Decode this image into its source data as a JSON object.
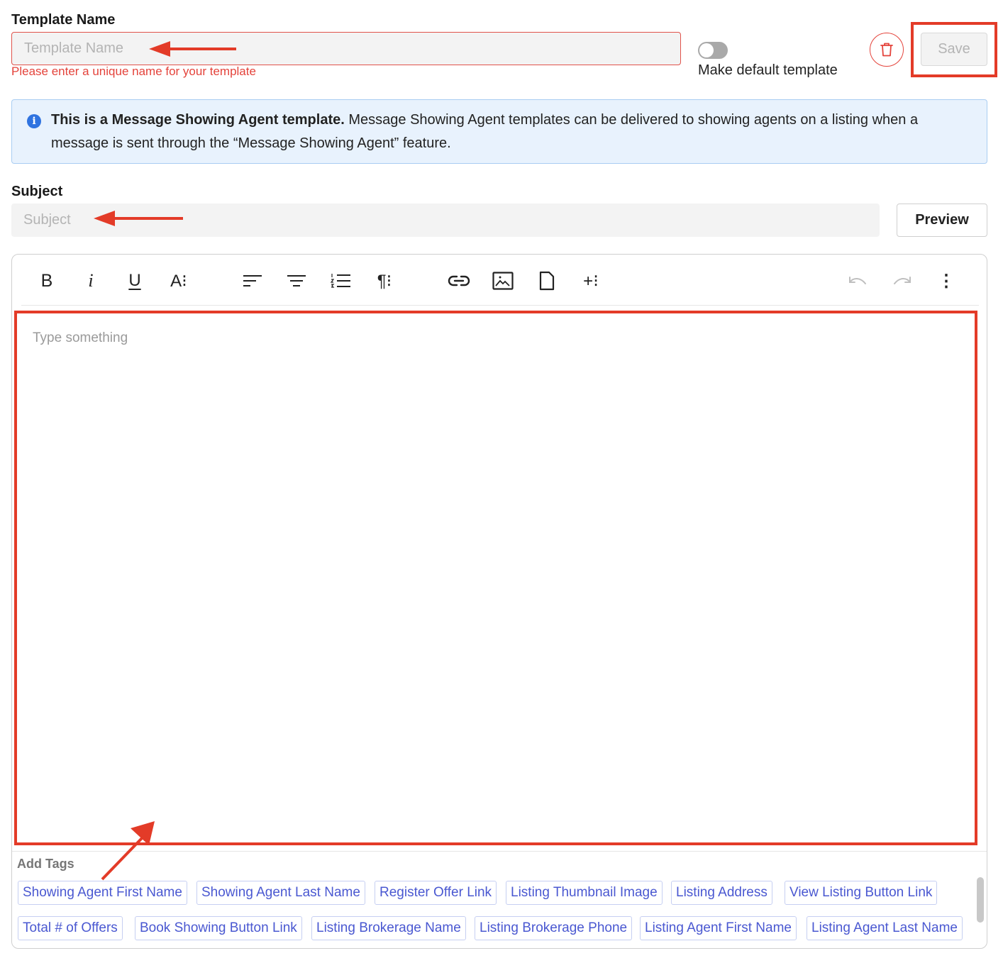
{
  "template_name": {
    "label": "Template Name",
    "placeholder": "Template Name",
    "value": "",
    "error": "Please enter a unique name for your template"
  },
  "default_toggle": {
    "label": "Make default template",
    "on": false
  },
  "actions": {
    "delete_icon": "trash-icon",
    "save_label": "Save"
  },
  "info_banner": {
    "icon": "info-icon",
    "icon_glyph": "i",
    "bold": "This is a Message Showing Agent template.",
    "text": " Message Showing Agent templates can be delivered to showing agents on a listing when a message is sent through the “Message Showing Agent” feature."
  },
  "subject": {
    "label": "Subject",
    "placeholder": "Subject",
    "value": "",
    "preview_label": "Preview"
  },
  "toolbar": {
    "bold": "B",
    "italic": "i",
    "underline": "U",
    "font_size": "A⁝",
    "paragraph": "¶⁝",
    "insert": "+⁝",
    "more": "⋮",
    "icons": [
      "bold-icon",
      "italic-icon",
      "underline-icon",
      "font-size-icon",
      "align-left-icon",
      "align-center-icon",
      "ordered-list-icon",
      "paragraph-icon",
      "link-icon",
      "image-icon",
      "file-icon",
      "insert-more-icon",
      "undo-icon",
      "redo-icon",
      "more-vertical-icon"
    ]
  },
  "editor": {
    "placeholder": "Type something",
    "value": ""
  },
  "tags": {
    "title": "Add Tags",
    "row1": [
      "Showing Agent First Name",
      "Showing Agent Last Name",
      "Register Offer Link",
      "Listing Thumbnail Image",
      "Listing Address",
      "View Listing Button Link"
    ],
    "row2": [
      "Total # of Offers",
      "Book Showing Button Link",
      "Listing Brokerage Name",
      "Listing Brokerage Phone",
      "Listing Agent First Name",
      "Listing Agent Last Name"
    ]
  },
  "colors": {
    "annotation": "#e33b28",
    "error": "#e4433b",
    "tag_text": "#4a58d1",
    "info_bg": "#e8f2fd",
    "info_icon": "#2f73e0"
  }
}
